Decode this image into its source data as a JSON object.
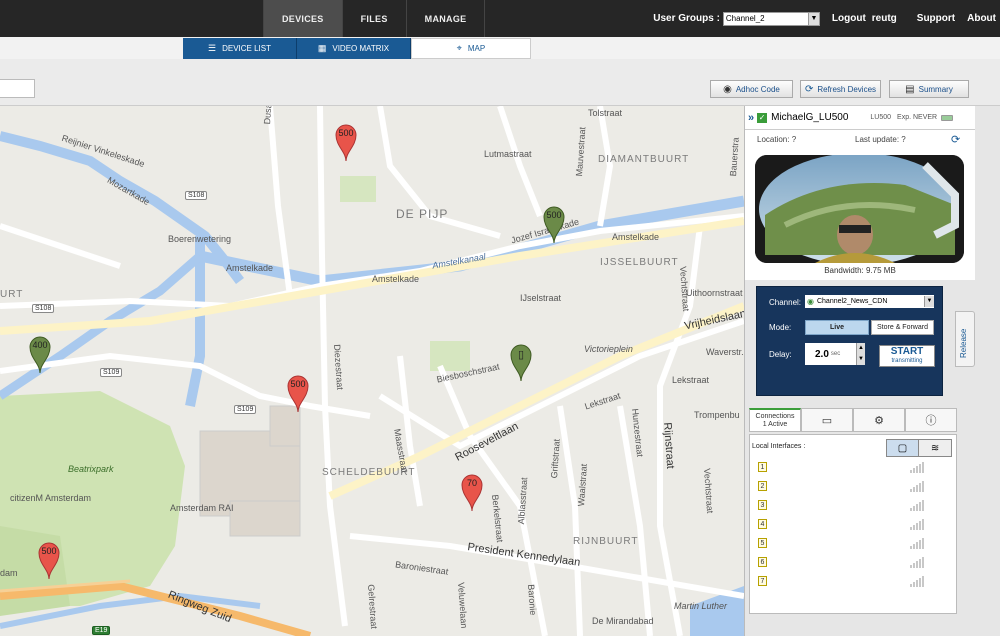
{
  "topbar": {
    "tabs": [
      {
        "label": "DEVICES",
        "active": true
      },
      {
        "label": "FILES",
        "active": false
      },
      {
        "label": "MANAGE",
        "active": false
      }
    ],
    "user_groups_label": "User Groups :",
    "user_group_value": "Channel_2",
    "logout": "Logout",
    "username": "reutg",
    "support": "Support",
    "about": "About"
  },
  "subtabs": [
    {
      "label": "DEVICE LIST",
      "icon": "list-icon",
      "active": false
    },
    {
      "label": "VIDEO MATRIX",
      "icon": "grid-icon",
      "active": false
    },
    {
      "label": "MAP",
      "icon": "map-icon",
      "active": true
    }
  ],
  "toolbar": {
    "adhoc": "Adhoc Code",
    "refresh": "Refresh Devices",
    "summary": "Summary"
  },
  "map": {
    "districts": [
      "DE PIJP",
      "DIAMANTBUURT",
      "IJSSELBUURT",
      "SCHELDEBUURT",
      "RIJNBUURT",
      "URT"
    ],
    "streets": [
      "Tolstraat",
      "Lutmastraat",
      "Dusartstraat",
      "Mauvestraat",
      "Reijnier Vinkeleskade",
      "Mozartkade",
      "Boerenwetering",
      "Amstelkade",
      "Amstelkade",
      "Amstelkanaal",
      "Jozef Israëlskade",
      "Amstelkade",
      "IJselstraat",
      "Uithoornstraat",
      "Vrijheidslaan",
      "Victorieplein",
      "Waverstr.",
      "Lekstraat",
      "Biesboschstraat",
      "Maasstraat",
      "Diezestraat",
      "Rooseveltlaan",
      "Lekstraat",
      "Trompenbu",
      "Hunzestraat",
      "Rijnstraat",
      "Vechtstraat",
      "Vechtstraat",
      "Beatrixpark",
      "citizenM Amsterdam",
      "Amsterdam RAI",
      "Berkelstraat",
      "Griftstraat",
      "Alblasstraat",
      "Waalstraat",
      "President Kennedylaan",
      "Baroniestraat",
      "Ringweg Zuid",
      "Gelrestraat",
      "Veluwelaan",
      "Baronie",
      "De Mirandabad",
      "Martin Luther",
      "Bauerstra",
      "Amsterdam",
      "Hoogstraat",
      "dam"
    ],
    "route_shields": [
      "S108",
      "S108",
      "S109",
      "S109",
      "E19"
    ],
    "markers": [
      {
        "label": "500",
        "color": "red"
      },
      {
        "label": "500",
        "color": "green"
      },
      {
        "label": "400",
        "color": "green"
      },
      {
        "label": "500",
        "color": "red"
      },
      {
        "label": "500",
        "color": "red"
      },
      {
        "label": "70",
        "color": "red"
      },
      {
        "label": "",
        "color": "green",
        "icon": "phone-icon"
      }
    ]
  },
  "panel": {
    "device_name": "MichaelG_LU500",
    "model": "LU500",
    "exp": "Exp. NEVER",
    "location": "Location: ?",
    "last_update": "Last update: ?",
    "bandwidth": "Bandwidth: 9.75 MB",
    "channel_label": "Channel:",
    "channel_value": "Channel2_News_CDN",
    "mode_label": "Mode:",
    "mode_live": "Live",
    "mode_sf": "Store & Forward",
    "delay_label": "Delay:",
    "delay_value": "2.0",
    "delay_unit": "sec",
    "start_line1": "START",
    "start_line2": "transmitting",
    "release": "Release",
    "connections_label": "Connections",
    "connections_active": "1 Active",
    "local_interfaces": "Local Interfaces :",
    "interfaces": [
      "1",
      "2",
      "3",
      "4",
      "5",
      "6",
      "7"
    ]
  }
}
